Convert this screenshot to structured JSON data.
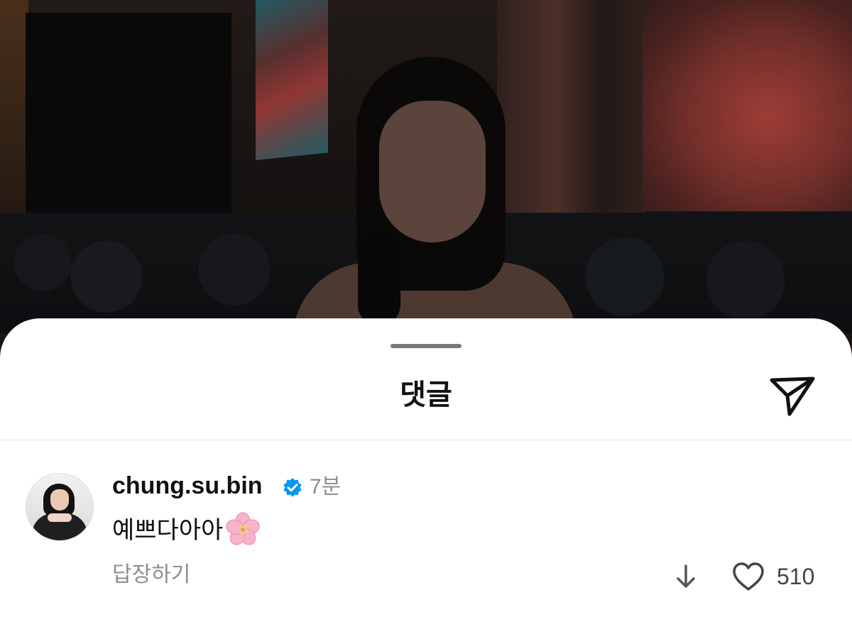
{
  "sheet": {
    "title": "댓글",
    "share_icon": "send-icon"
  },
  "comment": {
    "username": "chung.su.bin",
    "verified": true,
    "verified_color": "#0095f6",
    "time": "7분",
    "text": "예쁘다아아",
    "emoji": "cherry-blossom",
    "reply_label": "답장하기",
    "like_count": "510"
  },
  "colors": {
    "sheet_bg": "#ffffff",
    "muted_text": "#8e8e8e",
    "primary_text": "#111111"
  }
}
